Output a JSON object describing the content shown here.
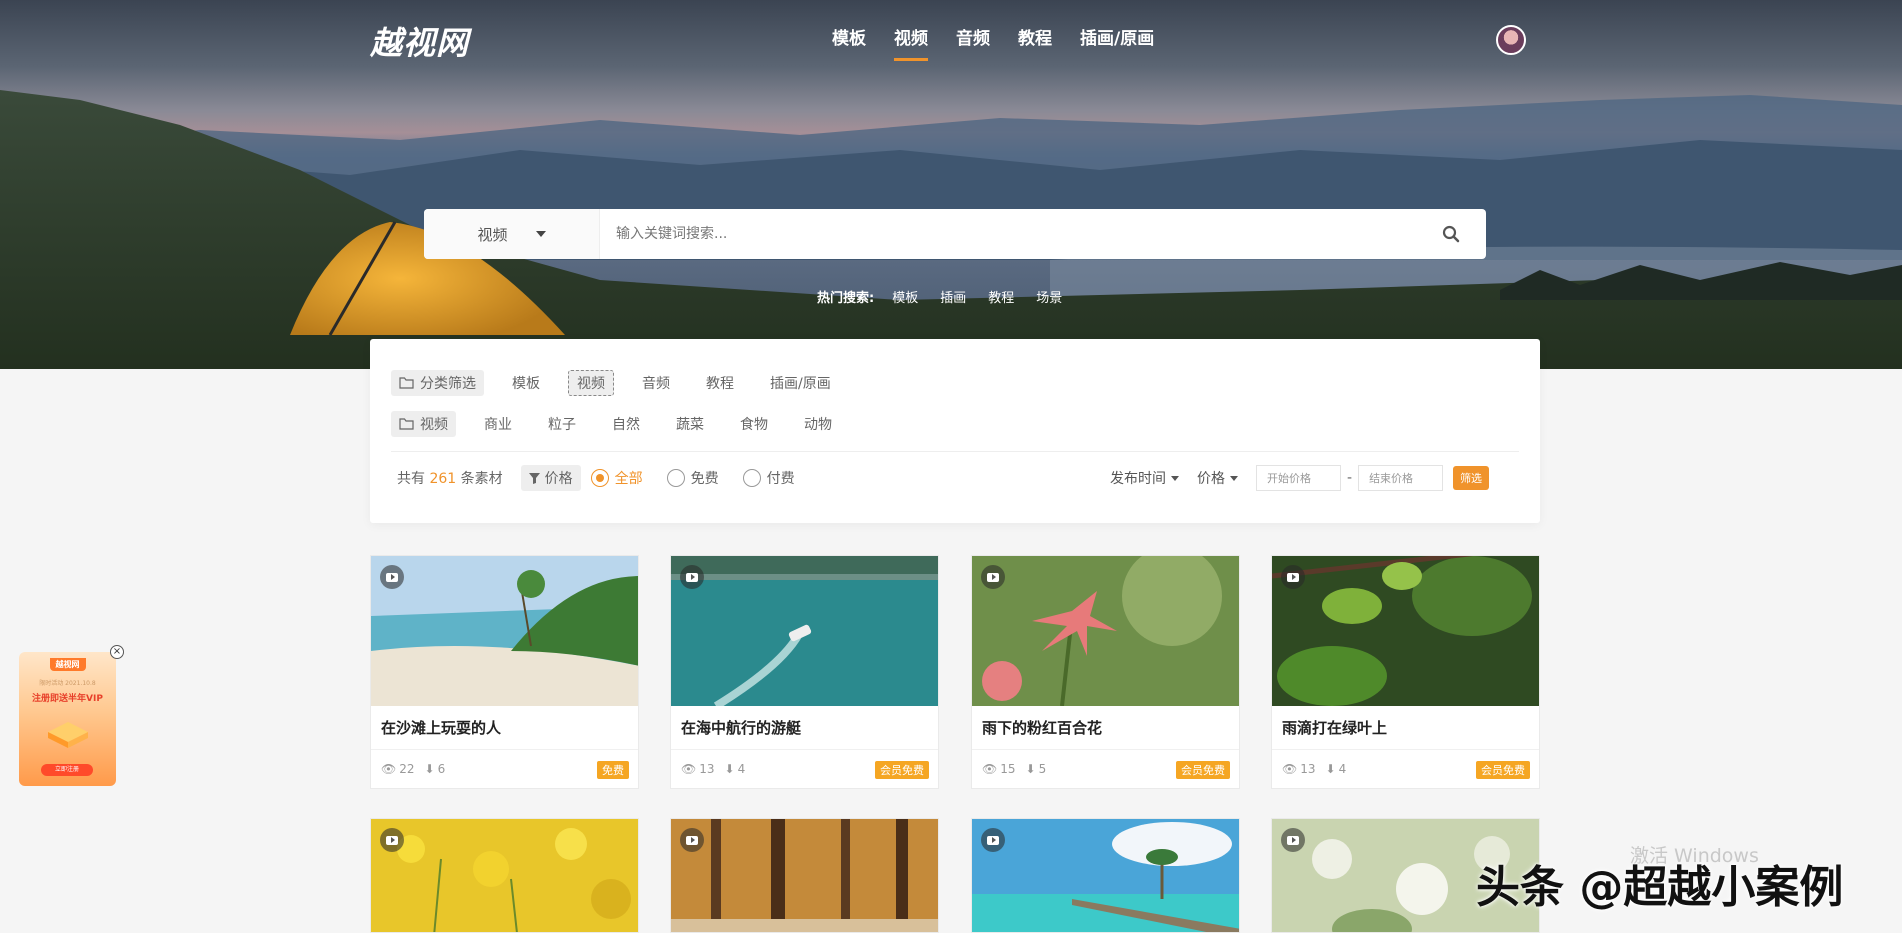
{
  "logo": "越视网",
  "nav": [
    {
      "label": "模板",
      "active": false
    },
    {
      "label": "视频",
      "active": true
    },
    {
      "label": "音频",
      "active": false
    },
    {
      "label": "教程",
      "active": false
    },
    {
      "label": "插画/原画",
      "active": false
    }
  ],
  "search": {
    "category": "视频",
    "placeholder": "输入关键词搜索...",
    "hot_label": "热门搜索:",
    "hot_items": [
      "模板",
      "插画",
      "教程",
      "场景"
    ]
  },
  "filter": {
    "row1_label": "分类筛选",
    "row1_items": [
      "模板",
      "视频",
      "音频",
      "教程",
      "插画/原画"
    ],
    "row1_selected": "视频",
    "row2_label": "视频",
    "row2_items": [
      "商业",
      "粒子",
      "自然",
      "蔬菜",
      "食物",
      "动物"
    ],
    "count_prefix": "共有",
    "count": "261",
    "count_suffix": "条素材",
    "price_label": "价格",
    "price_options": [
      "全部",
      "免费",
      "付费"
    ],
    "price_selected": "全部",
    "sort_time": "发布时间",
    "sort_price": "价格",
    "min_price_placeholder": "开始价格",
    "max_price_placeholder": "结束价格",
    "separator": "-",
    "submit": "筛选"
  },
  "cards": [
    {
      "title": "在沙滩上玩耍的人",
      "views": "22",
      "downloads": "6",
      "badge": "免费",
      "thumb": "beach-icon"
    },
    {
      "title": "在海中航行的游艇",
      "views": "13",
      "downloads": "4",
      "badge": "会员免费",
      "thumb": "boat-icon"
    },
    {
      "title": "雨下的粉红百合花",
      "views": "15",
      "downloads": "5",
      "badge": "会员免费",
      "thumb": "lily-icon"
    },
    {
      "title": "雨滴打在绿叶上",
      "views": "13",
      "downloads": "4",
      "badge": "会员免费",
      "thumb": "leaf-icon"
    },
    {
      "title": "",
      "views": "",
      "downloads": "",
      "badge": "",
      "thumb": "rapeseed-icon"
    },
    {
      "title": "",
      "views": "",
      "downloads": "",
      "badge": "",
      "thumb": "forest-icon"
    },
    {
      "title": "",
      "views": "",
      "downloads": "",
      "badge": "",
      "thumb": "pier-icon"
    },
    {
      "title": "",
      "views": "",
      "downloads": "",
      "badge": "",
      "thumb": "blossom-icon"
    }
  ],
  "promo": {
    "brand": "越视网",
    "date": "限时活动 2021.10.8",
    "title": "注册即送半年VIP",
    "button": "立即注册",
    "close": "×"
  },
  "watermarks": {
    "windows": "激活 Windows",
    "toutiao": "头条 @超越小案例"
  },
  "colors": {
    "accent": "#f0932b",
    "badge": "#f5a623"
  }
}
